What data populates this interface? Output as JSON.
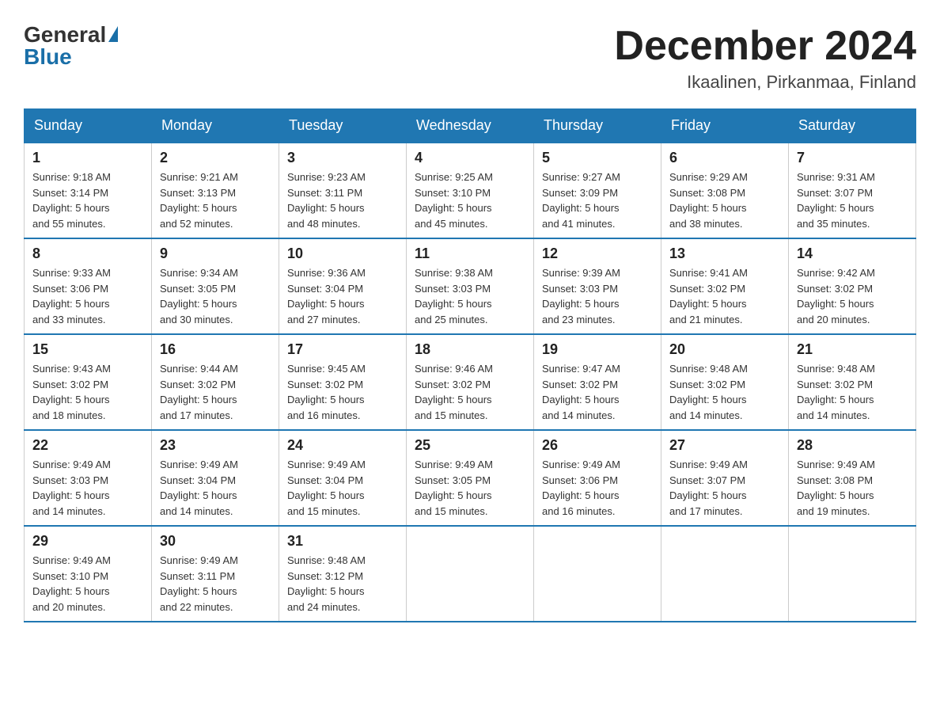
{
  "header": {
    "logo_general": "General",
    "logo_blue": "Blue",
    "title": "December 2024",
    "location": "Ikaalinen, Pirkanmaa, Finland"
  },
  "weekdays": [
    "Sunday",
    "Monday",
    "Tuesday",
    "Wednesday",
    "Thursday",
    "Friday",
    "Saturday"
  ],
  "weeks": [
    [
      {
        "day": "1",
        "sunrise": "9:18 AM",
        "sunset": "3:14 PM",
        "daylight": "5 hours and 55 minutes."
      },
      {
        "day": "2",
        "sunrise": "9:21 AM",
        "sunset": "3:13 PM",
        "daylight": "5 hours and 52 minutes."
      },
      {
        "day": "3",
        "sunrise": "9:23 AM",
        "sunset": "3:11 PM",
        "daylight": "5 hours and 48 minutes."
      },
      {
        "day": "4",
        "sunrise": "9:25 AM",
        "sunset": "3:10 PM",
        "daylight": "5 hours and 45 minutes."
      },
      {
        "day": "5",
        "sunrise": "9:27 AM",
        "sunset": "3:09 PM",
        "daylight": "5 hours and 41 minutes."
      },
      {
        "day": "6",
        "sunrise": "9:29 AM",
        "sunset": "3:08 PM",
        "daylight": "5 hours and 38 minutes."
      },
      {
        "day": "7",
        "sunrise": "9:31 AM",
        "sunset": "3:07 PM",
        "daylight": "5 hours and 35 minutes."
      }
    ],
    [
      {
        "day": "8",
        "sunrise": "9:33 AM",
        "sunset": "3:06 PM",
        "daylight": "5 hours and 33 minutes."
      },
      {
        "day": "9",
        "sunrise": "9:34 AM",
        "sunset": "3:05 PM",
        "daylight": "5 hours and 30 minutes."
      },
      {
        "day": "10",
        "sunrise": "9:36 AM",
        "sunset": "3:04 PM",
        "daylight": "5 hours and 27 minutes."
      },
      {
        "day": "11",
        "sunrise": "9:38 AM",
        "sunset": "3:03 PM",
        "daylight": "5 hours and 25 minutes."
      },
      {
        "day": "12",
        "sunrise": "9:39 AM",
        "sunset": "3:03 PM",
        "daylight": "5 hours and 23 minutes."
      },
      {
        "day": "13",
        "sunrise": "9:41 AM",
        "sunset": "3:02 PM",
        "daylight": "5 hours and 21 minutes."
      },
      {
        "day": "14",
        "sunrise": "9:42 AM",
        "sunset": "3:02 PM",
        "daylight": "5 hours and 20 minutes."
      }
    ],
    [
      {
        "day": "15",
        "sunrise": "9:43 AM",
        "sunset": "3:02 PM",
        "daylight": "5 hours and 18 minutes."
      },
      {
        "day": "16",
        "sunrise": "9:44 AM",
        "sunset": "3:02 PM",
        "daylight": "5 hours and 17 minutes."
      },
      {
        "day": "17",
        "sunrise": "9:45 AM",
        "sunset": "3:02 PM",
        "daylight": "5 hours and 16 minutes."
      },
      {
        "day": "18",
        "sunrise": "9:46 AM",
        "sunset": "3:02 PM",
        "daylight": "5 hours and 15 minutes."
      },
      {
        "day": "19",
        "sunrise": "9:47 AM",
        "sunset": "3:02 PM",
        "daylight": "5 hours and 14 minutes."
      },
      {
        "day": "20",
        "sunrise": "9:48 AM",
        "sunset": "3:02 PM",
        "daylight": "5 hours and 14 minutes."
      },
      {
        "day": "21",
        "sunrise": "9:48 AM",
        "sunset": "3:02 PM",
        "daylight": "5 hours and 14 minutes."
      }
    ],
    [
      {
        "day": "22",
        "sunrise": "9:49 AM",
        "sunset": "3:03 PM",
        "daylight": "5 hours and 14 minutes."
      },
      {
        "day": "23",
        "sunrise": "9:49 AM",
        "sunset": "3:04 PM",
        "daylight": "5 hours and 14 minutes."
      },
      {
        "day": "24",
        "sunrise": "9:49 AM",
        "sunset": "3:04 PM",
        "daylight": "5 hours and 15 minutes."
      },
      {
        "day": "25",
        "sunrise": "9:49 AM",
        "sunset": "3:05 PM",
        "daylight": "5 hours and 15 minutes."
      },
      {
        "day": "26",
        "sunrise": "9:49 AM",
        "sunset": "3:06 PM",
        "daylight": "5 hours and 16 minutes."
      },
      {
        "day": "27",
        "sunrise": "9:49 AM",
        "sunset": "3:07 PM",
        "daylight": "5 hours and 17 minutes."
      },
      {
        "day": "28",
        "sunrise": "9:49 AM",
        "sunset": "3:08 PM",
        "daylight": "5 hours and 19 minutes."
      }
    ],
    [
      {
        "day": "29",
        "sunrise": "9:49 AM",
        "sunset": "3:10 PM",
        "daylight": "5 hours and 20 minutes."
      },
      {
        "day": "30",
        "sunrise": "9:49 AM",
        "sunset": "3:11 PM",
        "daylight": "5 hours and 22 minutes."
      },
      {
        "day": "31",
        "sunrise": "9:48 AM",
        "sunset": "3:12 PM",
        "daylight": "5 hours and 24 minutes."
      },
      null,
      null,
      null,
      null
    ]
  ],
  "labels": {
    "sunrise": "Sunrise:",
    "sunset": "Sunset:",
    "daylight": "Daylight:"
  }
}
